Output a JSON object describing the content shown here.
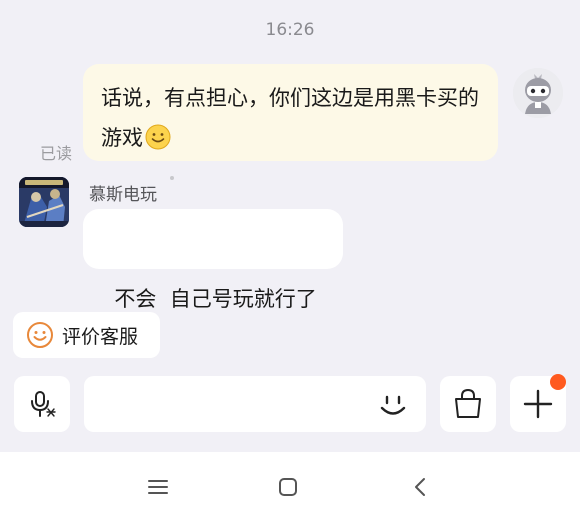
{
  "status": {
    "time": "16:26"
  },
  "messages": {
    "outgoing": {
      "text": "话说，有点担心，你们这边是用黑卡买的游戏",
      "emoji": "smiling-face-emoji",
      "read_status": "已读"
    },
    "incoming": {
      "sender": "慕斯电玩",
      "text": "不会  自己号玩就行了"
    }
  },
  "actions": {
    "rate_service_label": "评价客服"
  },
  "input_bar": {
    "input_value": "",
    "icons": [
      "voice-to-text-icon",
      "smile-icon",
      "shopping-bag-icon",
      "plus-icon"
    ],
    "notification_dot_color": "#ff5a1f"
  },
  "navigation": {
    "icons": [
      "menu-icon",
      "home-icon",
      "back-icon"
    ]
  },
  "colors": {
    "outgoing_bubble": "#fdf9e7",
    "incoming_bubble": "#ffffff",
    "background": "#f1f0f6",
    "rate_icon": "#e8883a"
  }
}
